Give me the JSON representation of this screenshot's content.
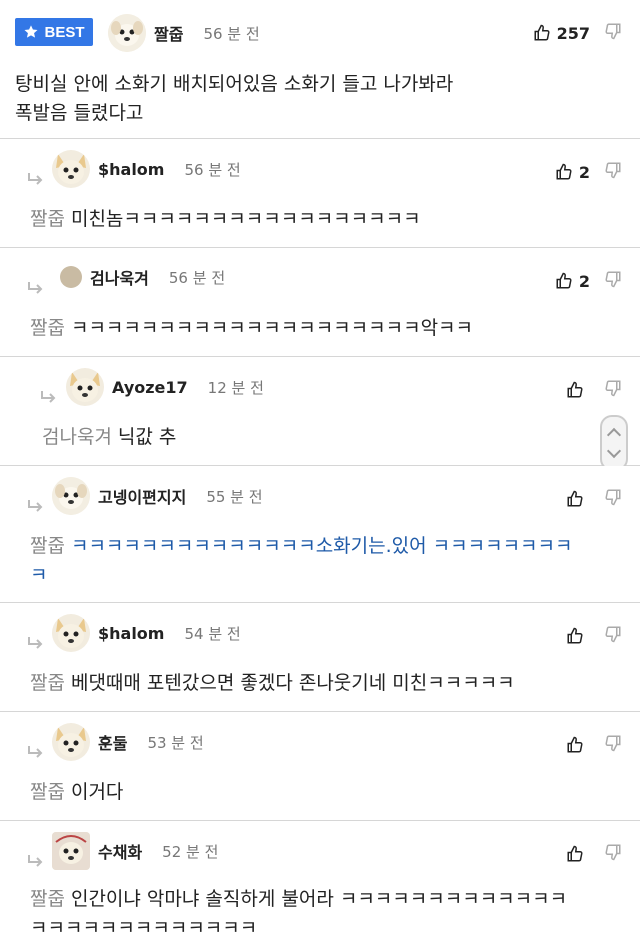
{
  "best": {
    "badge": "BEST",
    "author": "짤줍",
    "time": "56 분 전",
    "upvotes": "257",
    "text_line1": "탕비실 안에 소화기 배치되어있음 소화기 들고 나가봐라",
    "text_line2": "폭발음 들렸다고"
  },
  "comments": [
    {
      "author": "$halom",
      "time": "56 분 전",
      "upvotes": "2",
      "mention": "짤줍",
      "text": "미친놈ㅋㅋㅋㅋㅋㅋㅋㅋㅋㅋㅋㅋㅋㅋㅋㅋㅋ"
    },
    {
      "author": "검나욱겨",
      "time": "56 분 전",
      "upvotes": "2",
      "mention": "짤줍",
      "text": "ㅋㅋㅋㅋㅋㅋㅋㅋㅋㅋㅋㅋㅋㅋㅋㅋㅋㅋㅋㅋ악ㅋㅋ"
    },
    {
      "author": "Ayoze17",
      "time": "12 분 전",
      "upvotes": "",
      "mention": "검나욱겨",
      "text": "닉값 추"
    },
    {
      "author": "고넹이편지지",
      "time": "55 분 전",
      "upvotes": "",
      "mention": "짤줍",
      "text_line1": "ㅋㅋㅋㅋㅋㅋㅋㅋㅋㅋㅋㅋㅋㅋ소화기는.있어 ㅋㅋㅋㅋㅋㅋㅋㅋ",
      "text_line2": "ㅋ"
    },
    {
      "author": "$halom",
      "time": "54 분 전",
      "upvotes": "",
      "mention": "짤줍",
      "text": "베댓때매 포텐갔으면 좋겠다 존나웃기네 미친ㅋㅋㅋㅋㅋ"
    },
    {
      "author": "훈둘",
      "time": "53 분 전",
      "upvotes": "",
      "mention": "짤줍",
      "text": "이거다"
    },
    {
      "author": "수채화",
      "time": "52 분 전",
      "upvotes": "",
      "mention": "짤줍",
      "text_line1": "인간이냐 악마냐 솔직하게 불어라 ㅋㅋㅋㅋㅋㅋㅋㅋㅋㅋㅋㅋㅋ",
      "text_line2": "ㅋㅋㅋㅋㅋㅋㅋㅋㅋㅋㅋㅋㅋ"
    }
  ]
}
